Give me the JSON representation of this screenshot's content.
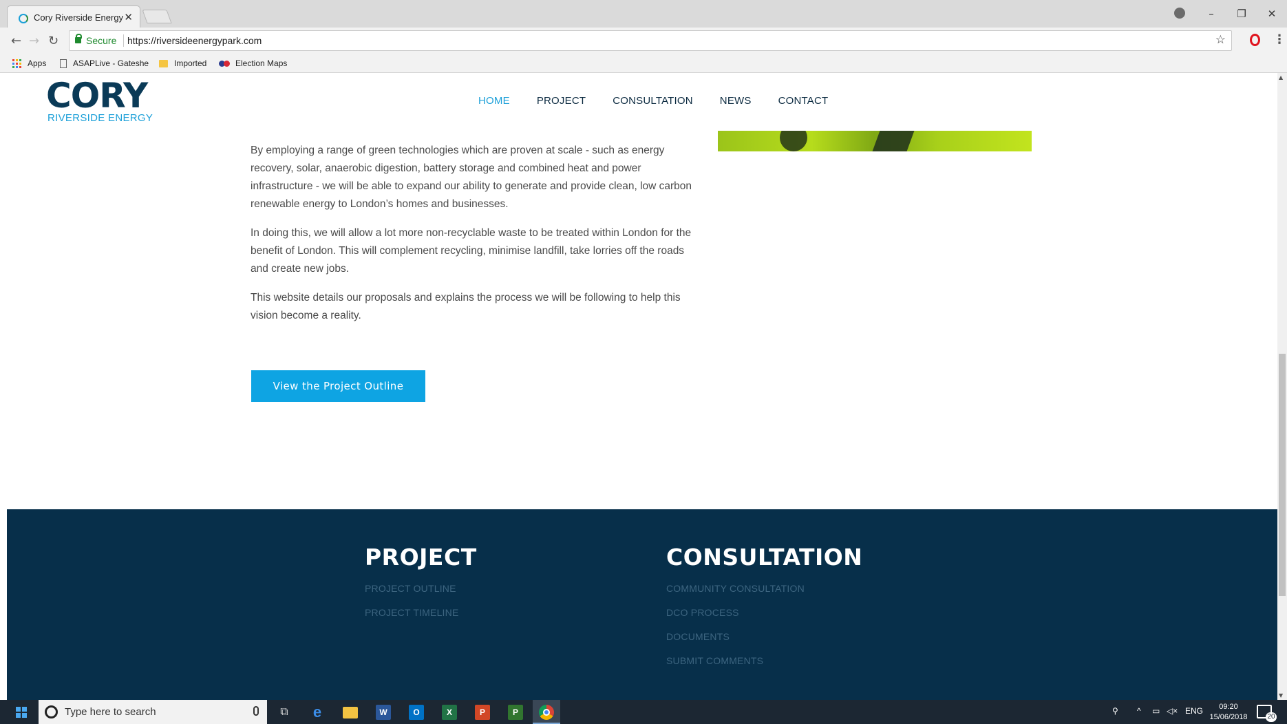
{
  "browser": {
    "tab_title": "Cory Riverside Energy Pa",
    "tab_close": "✕",
    "window_controls": {
      "minimize": "–",
      "restore": "❐",
      "close": "✕"
    },
    "secure_label": "Secure",
    "url": "https://riversideenergypark.com",
    "bookmarks": [
      {
        "label": "Apps",
        "icon": "apps-grid-icon"
      },
      {
        "label": "ASAPLive - Gateshe",
        "icon": "page-icon"
      },
      {
        "label": "Imported",
        "icon": "folder-icon"
      },
      {
        "label": "Election Maps",
        "icon": "election-maps-icon"
      }
    ]
  },
  "site": {
    "logo": {
      "word": "CORY",
      "sub": "RIVERSIDE ENERGY"
    },
    "nav": [
      {
        "label": "HOME",
        "active": true
      },
      {
        "label": "PROJECT",
        "active": false
      },
      {
        "label": "CONSULTATION",
        "active": false
      },
      {
        "label": "NEWS",
        "active": false
      },
      {
        "label": "CONTACT",
        "active": false
      }
    ],
    "paragraphs": [
      "By employing a range of green technologies which are proven at scale - such as energy recovery, solar, anaerobic digestion, battery storage and combined heat and power infrastructure - we will be able to expand our ability to generate and provide clean, low carbon renewable energy to London’s homes and businesses.",
      "In doing this, we will allow a lot more non-recyclable waste to be treated within London for the benefit of London. This will complement recycling, minimise landfill, take lorries off the roads and create new jobs.",
      "This website details our proposals and explains the process we will be following to help this vision become a reality."
    ],
    "cta_label": "View the Project Outline",
    "footer": {
      "project": {
        "heading": "PROJECT",
        "links": [
          "PROJECT OUTLINE",
          "PROJECT TIMELINE"
        ]
      },
      "consultation": {
        "heading": "CONSULTATION",
        "links": [
          "COMMUNITY CONSULTATION",
          "DCO PROCESS",
          "DOCUMENTS",
          "SUBMIT COMMENTS"
        ]
      }
    }
  },
  "taskbar": {
    "search_placeholder": "Type here to search",
    "apps": [
      {
        "name": "task-view",
        "glyph": "⧉"
      },
      {
        "name": "edge",
        "glyph": "e"
      },
      {
        "name": "file-explorer",
        "glyph": ""
      },
      {
        "name": "word",
        "glyph": "W"
      },
      {
        "name": "outlook",
        "glyph": "O"
      },
      {
        "name": "excel",
        "glyph": "X"
      },
      {
        "name": "powerpoint",
        "glyph": "P"
      },
      {
        "name": "project",
        "glyph": "P"
      },
      {
        "name": "chrome",
        "glyph": ""
      }
    ],
    "language": "ENG",
    "time": "09:20",
    "date": "15/06/2018",
    "notification_count": "20"
  },
  "colors": {
    "accent": "#1a9fd8",
    "cta": "#0ea4e3",
    "footer_bg": "#072f4a",
    "logo_dark": "#0a3a57"
  }
}
